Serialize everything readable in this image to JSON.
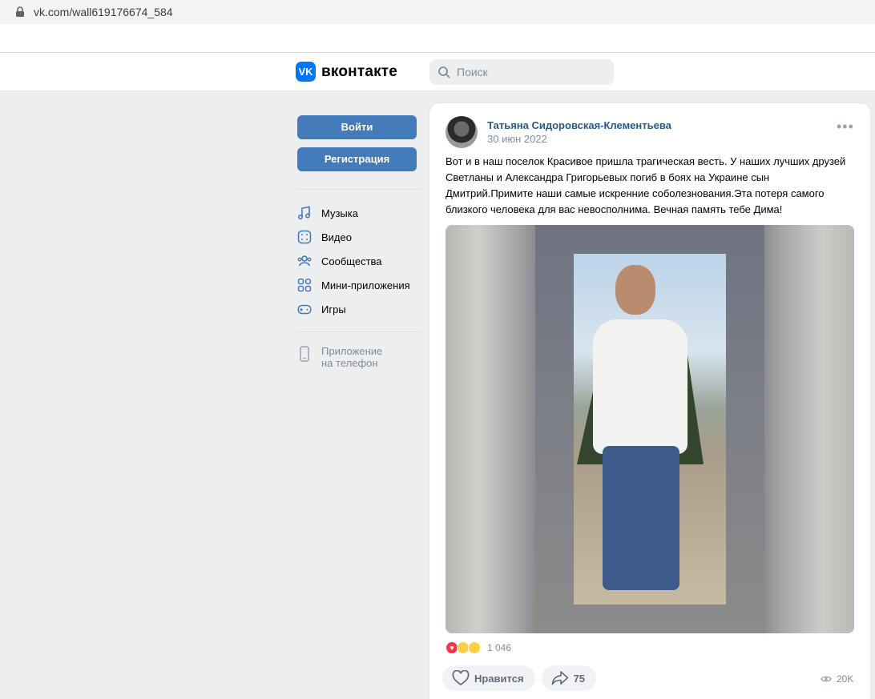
{
  "browser": {
    "url": "vk.com/wall619176674_584"
  },
  "header": {
    "logo_text": "вконтакте",
    "logo_mark": "VK",
    "search_placeholder": "Поиск"
  },
  "sidebar": {
    "login_label": "Войти",
    "register_label": "Регистрация",
    "items": [
      {
        "label": "Музыка",
        "icon": "music-icon"
      },
      {
        "label": "Видео",
        "icon": "video-icon"
      },
      {
        "label": "Сообщества",
        "icon": "communities-icon"
      },
      {
        "label": "Мини-приложения",
        "icon": "mini-apps-icon"
      },
      {
        "label": "Игры",
        "icon": "games-icon"
      }
    ],
    "app_line1": "Приложение",
    "app_line2": "на телефон"
  },
  "post": {
    "author": "Татьяна Сидоровская-Клементьева",
    "date": "30 июн 2022",
    "more": "•••",
    "text": "Вот и в наш поселок Красивое пришла трагическая весть. У наших лучших друзей Светланы и Александра Григорьевых погиб в боях на Украине сын Дмитрий.Примите наши самые искренние соболезнования.Эта потеря самого близкого человека для вас невосполнима. Вечная память тебе Дима!",
    "reactions_count": "1 046",
    "like_label": "Нравится",
    "share_count": "75",
    "views": "20K"
  },
  "colors": {
    "accent": "#447bba",
    "link": "#2a5885",
    "vk_blue": "#0077ff"
  }
}
